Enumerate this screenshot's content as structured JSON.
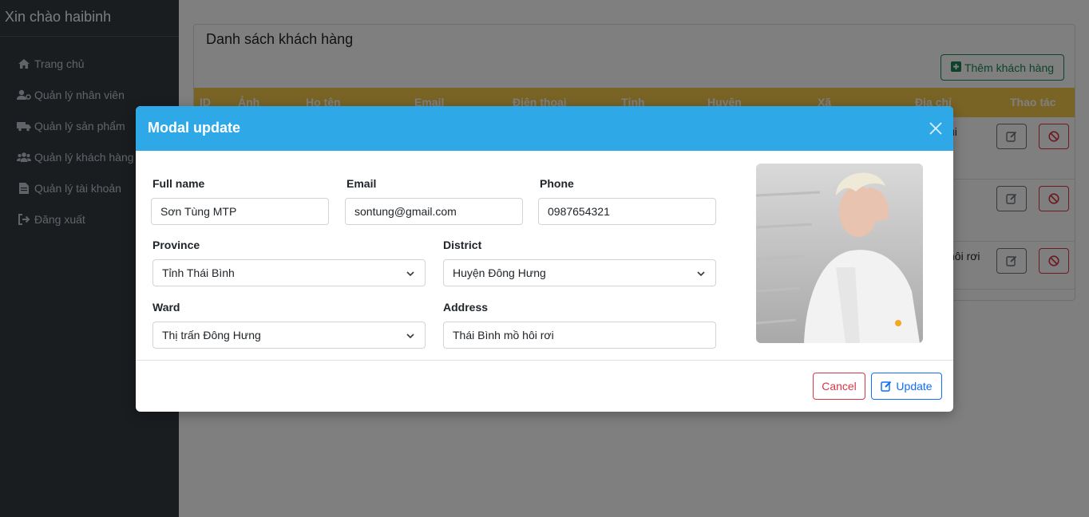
{
  "sidebar": {
    "greeting": "Xin chào haibinh",
    "items": [
      {
        "label": "Trang chủ",
        "icon": "home-icon"
      },
      {
        "label": "Quản lý nhân viên",
        "icon": "user-gear-icon"
      },
      {
        "label": "Quản lý sản phẩm",
        "icon": "truck-icon"
      },
      {
        "label": "Quản lý khách hàng",
        "icon": "users-icon"
      },
      {
        "label": "Quản lý tài khoản",
        "icon": "file-icon"
      },
      {
        "label": "Đăng xuất",
        "icon": "sign-out-icon"
      }
    ]
  },
  "main": {
    "card_title": "Danh sách khách hàng",
    "add_button": "Thêm khách hàng",
    "columns": [
      "ID",
      "Ảnh",
      "Họ tên",
      "Email",
      "Điện thoại",
      "Tỉnh",
      "Huyện",
      "Xã",
      "Địa chỉ",
      "Thao tác"
    ],
    "rows": [
      {
        "address": "ui"
      },
      {
        "address": ""
      },
      {
        "address": "hôi rơi"
      }
    ]
  },
  "modal": {
    "title": "Modal update",
    "labels": {
      "full_name": "Full name",
      "email": "Email",
      "phone": "Phone",
      "province": "Province",
      "district": "District",
      "ward": "Ward",
      "address": "Address"
    },
    "values": {
      "full_name": "Sơn Tùng MTP",
      "email": "sontung@gmail.com",
      "phone": "0987654321",
      "province": "Tỉnh Thái Bình",
      "district": "Huyện Đông Hưng",
      "ward": "Thị trấn Đông Hưng",
      "address": "Thái Bình mồ hôi rơi"
    },
    "cancel_label": "Cancel",
    "update_label": "Update"
  },
  "colors": {
    "modal_header": "#2fa8e8",
    "table_header": "#f2c94c",
    "sidebar": "#343a40",
    "success": "#198754",
    "danger": "#dc3545",
    "primary": "#0d6efd"
  }
}
